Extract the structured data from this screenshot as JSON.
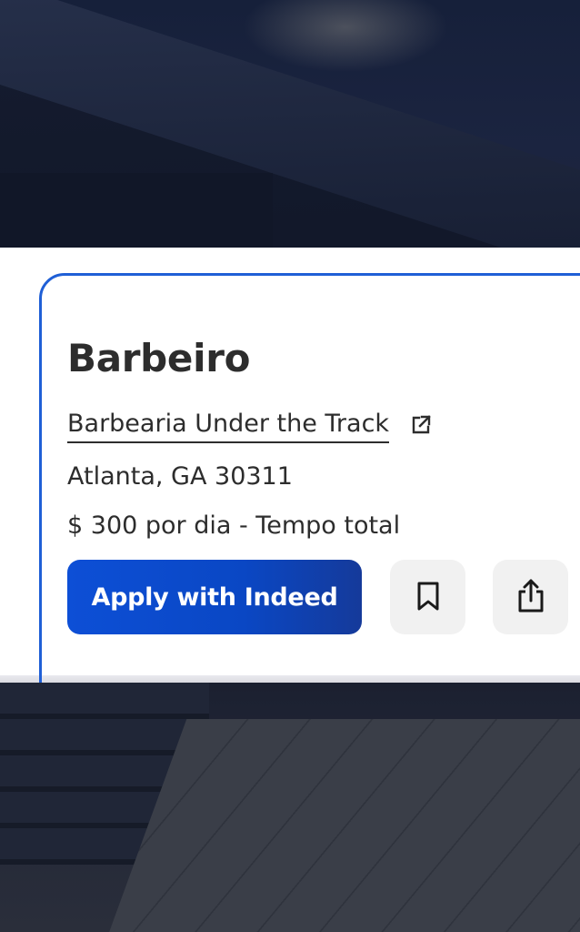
{
  "job": {
    "title": "Barbeiro",
    "company": "Barbearia Under the Track",
    "location": "Atlanta, GA 30311",
    "salary": "$ 300 por dia - Tempo total"
  },
  "actions": {
    "apply_label": "Apply with Indeed",
    "save_icon": "bookmark-icon",
    "share_icon": "share-icon",
    "external_icon": "external-link-icon"
  },
  "colors": {
    "accent": "#1f5fd6",
    "apply_button": "#0d4fd6",
    "text": "#2d2d2d",
    "icon_button_bg": "#f1f1f1"
  }
}
